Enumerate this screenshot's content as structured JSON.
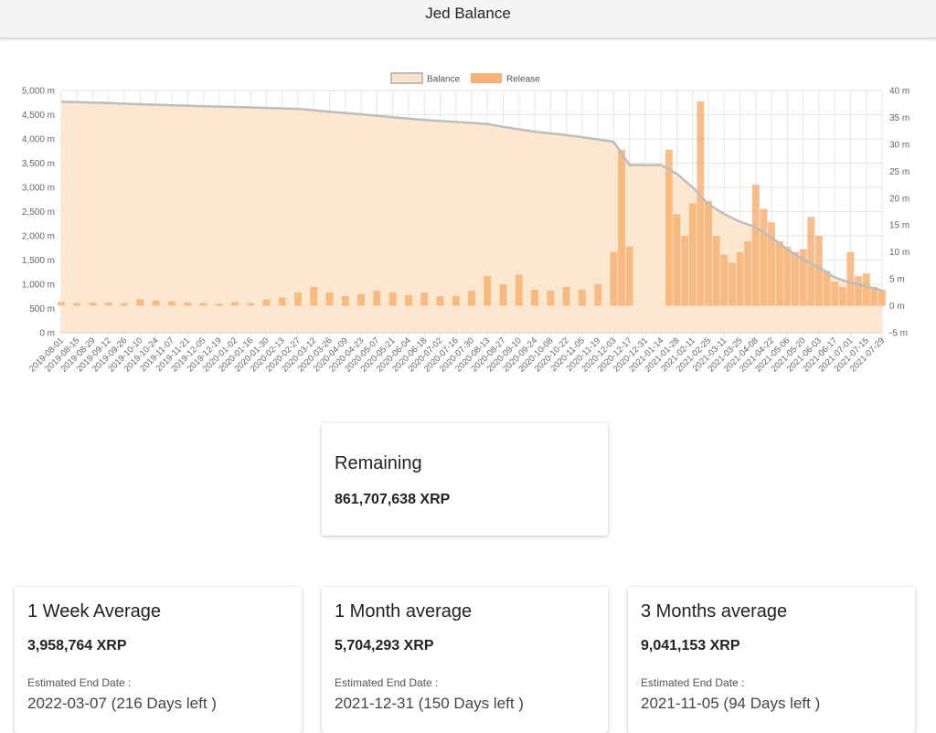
{
  "header": {
    "title": "Jed Balance"
  },
  "chart_data": {
    "type": "bar",
    "title": "",
    "legend": [
      {
        "name": "Balance",
        "type": "line-area",
        "fill": "#fbe3c8",
        "stroke": "#bdbdbd"
      },
      {
        "name": "Release",
        "type": "bar",
        "fill": "#f6b275"
      }
    ],
    "legend_position": "top-center",
    "grid": true,
    "y_left": {
      "ticks": [
        "0 m",
        "500 m",
        "1,000 m",
        "1,500 m",
        "2,000 m",
        "2,500 m",
        "3,000 m",
        "3,500 m",
        "4,000 m",
        "4,500 m",
        "5,000 m"
      ],
      "range": [
        0,
        5000
      ],
      "unit": "million XRP"
    },
    "y_right": {
      "ticks": [
        "-5 m",
        "0 m",
        "5 m",
        "10 m",
        "15 m",
        "20 m",
        "25 m",
        "30 m",
        "35 m",
        "40 m"
      ],
      "range": [
        -5,
        40
      ],
      "unit": "million XRP"
    },
    "x_ticks": [
      "2019-08-01",
      "2019-08-15",
      "2019-08-29",
      "2019-09-12",
      "2019-09-26",
      "2019-10-10",
      "2019-10-24",
      "2019-11-07",
      "2019-11-21",
      "2019-12-05",
      "2019-12-19",
      "2020-01-02",
      "2020-01-16",
      "2020-01-30",
      "2020-02-13",
      "2020-02-27",
      "2020-03-12",
      "2020-03-26",
      "2020-04-09",
      "2020-04-23",
      "2020-05-07",
      "2020-05-21",
      "2020-06-04",
      "2020-06-18",
      "2020-07-02",
      "2020-07-16",
      "2020-07-30",
      "2020-08-13",
      "2020-08-27",
      "2020-09-10",
      "2020-09-24",
      "2020-10-08",
      "2020-10-22",
      "2020-11-05",
      "2020-11-19",
      "2020-12-03",
      "2020-12-17",
      "2020-12-31",
      "2021-01-14",
      "2021-01-28",
      "2021-02-11",
      "2021-02-25",
      "2021-03-11",
      "2021-03-25",
      "2021-04-08",
      "2021-04-22",
      "2021-05-06",
      "2021-05-20",
      "2021-06-03",
      "2021-06-17",
      "2021-07-01",
      "2021-07-15",
      "2021-07-29"
    ],
    "balance_series": {
      "name": "Balance",
      "x": [
        "2019-08-01",
        "2019-09-12",
        "2019-10-24",
        "2019-12-05",
        "2020-01-16",
        "2020-02-27",
        "2020-03-26",
        "2020-04-23",
        "2020-05-21",
        "2020-06-18",
        "2020-07-16",
        "2020-08-13",
        "2020-08-27",
        "2020-09-24",
        "2020-10-22",
        "2020-11-19",
        "2020-12-03",
        "2020-12-17",
        "2021-01-14",
        "2021-01-28",
        "2021-02-11",
        "2021-02-25",
        "2021-03-11",
        "2021-03-25",
        "2021-04-08",
        "2021-04-22",
        "2021-05-06",
        "2021-05-20",
        "2021-06-03",
        "2021-06-17",
        "2021-07-01",
        "2021-07-15",
        "2021-07-29"
      ],
      "values": [
        4770,
        4740,
        4705,
        4675,
        4650,
        4620,
        4560,
        4510,
        4450,
        4390,
        4350,
        4310,
        4250,
        4150,
        4080,
        3990,
        3940,
        3460,
        3460,
        3280,
        3000,
        2650,
        2450,
        2290,
        2180,
        1970,
        1720,
        1510,
        1350,
        1140,
        1030,
        960,
        870
      ]
    },
    "release_series": {
      "name": "Release",
      "x": [
        "2019-08-01",
        "2019-08-15",
        "2019-08-29",
        "2019-09-12",
        "2019-09-26",
        "2019-10-10",
        "2019-10-24",
        "2019-11-07",
        "2019-11-21",
        "2019-12-05",
        "2019-12-19",
        "2020-01-02",
        "2020-01-16",
        "2020-01-30",
        "2020-02-13",
        "2020-02-27",
        "2020-03-12",
        "2020-03-26",
        "2020-04-09",
        "2020-04-23",
        "2020-05-07",
        "2020-05-21",
        "2020-06-04",
        "2020-06-18",
        "2020-07-02",
        "2020-07-16",
        "2020-07-30",
        "2020-08-13",
        "2020-08-27",
        "2020-09-10",
        "2020-09-24",
        "2020-10-08",
        "2020-10-22",
        "2020-11-05",
        "2020-11-19",
        "2020-12-03",
        "2020-12-10",
        "2020-12-17",
        "2021-01-21",
        "2021-01-28",
        "2021-02-04",
        "2021-02-11",
        "2021-02-18",
        "2021-02-25",
        "2021-03-04",
        "2021-03-11",
        "2021-03-18",
        "2021-03-25",
        "2021-04-01",
        "2021-04-08",
        "2021-04-15",
        "2021-04-22",
        "2021-04-29",
        "2021-05-06",
        "2021-05-13",
        "2021-05-20",
        "2021-05-27",
        "2021-06-03",
        "2021-06-10",
        "2021-06-17",
        "2021-06-24",
        "2021-07-01",
        "2021-07-08",
        "2021-07-15",
        "2021-07-22",
        "2021-07-29"
      ],
      "values": [
        0.7,
        0.5,
        0.6,
        0.6,
        0.5,
        1.2,
        1.0,
        0.8,
        0.6,
        0.5,
        0.4,
        0.7,
        0.5,
        1.2,
        1.5,
        2.5,
        3.5,
        2.5,
        1.8,
        2.2,
        2.8,
        2.5,
        2.0,
        2.5,
        1.8,
        1.8,
        2.8,
        5.5,
        4.0,
        5.8,
        3.0,
        2.8,
        3.5,
        3.0,
        4.0,
        10.0,
        29.0,
        11.0,
        29.0,
        17.0,
        13.0,
        19.0,
        38.0,
        19.5,
        13.0,
        9.5,
        8.0,
        10.0,
        12.0,
        22.5,
        18.0,
        15.5,
        12.0,
        11.0,
        10.0,
        10.5,
        16.5,
        13.0,
        6.5,
        4.5,
        3.5,
        10.0,
        5.5,
        6.0,
        3.5,
        3.0
      ]
    }
  },
  "cards": {
    "remaining": {
      "title": "Remaining",
      "value": "861,707,638 XRP"
    },
    "week": {
      "title": "1 Week Average",
      "value": "3,958,764 XRP",
      "end_label": "Estimated End Date :",
      "end_value": "2022-03-07 (216 Days left )"
    },
    "month": {
      "title": "1 Month average",
      "value": "5,704,293 XRP",
      "end_label": "Estimated End Date :",
      "end_value": "2021-12-31 (150 Days left )"
    },
    "months3": {
      "title": "3 Months average",
      "value": "9,041,153 XRP",
      "end_label": "Estimated End Date :",
      "end_value": "2021-11-05 (94 Days left )"
    }
  }
}
